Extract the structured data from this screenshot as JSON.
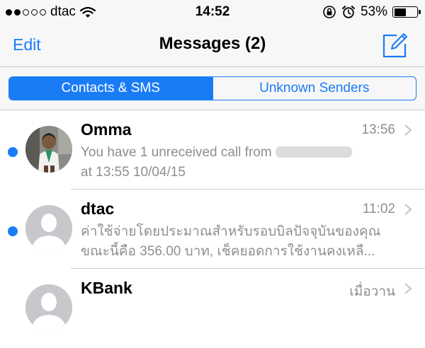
{
  "status_bar": {
    "signal_dots": [
      true,
      true,
      false,
      false,
      false
    ],
    "carrier": "dtac",
    "time": "14:52",
    "battery_percent": "53%",
    "battery_level": 0.53
  },
  "nav": {
    "edit_label": "Edit",
    "title": "Messages (2)",
    "compose_icon": "compose-icon"
  },
  "segments": {
    "items": [
      {
        "label": "Contacts & SMS",
        "active": true
      },
      {
        "label": "Unknown Senders",
        "active": false
      }
    ]
  },
  "messages": [
    {
      "name": "Omma",
      "time": "13:56",
      "unread": true,
      "avatar": "photo",
      "preview_line1": "You have 1 unreceived call from",
      "preview_line2": "at 13:55 10/04/15",
      "redacted_number": true
    },
    {
      "name": "dtac",
      "time": "11:02",
      "unread": true,
      "avatar": "placeholder",
      "preview_line1": "ค่าใช้จ่ายโดยประมาณสำหรับรอบบิลปัจจุบันของคุณ",
      "preview_line2": "ขณะนี้คือ 356.00 บาท, เช็คยอดการใช้งานคงเหลื..."
    },
    {
      "name": "KBank",
      "time": "เมื่อวาน",
      "unread": false,
      "avatar": "placeholder",
      "preview_line1": "",
      "preview_line2": ""
    }
  ],
  "colors": {
    "accent": "#1a7cf5",
    "secondary_text": "#8e8e93",
    "bar_background": "#f7f7f7"
  }
}
